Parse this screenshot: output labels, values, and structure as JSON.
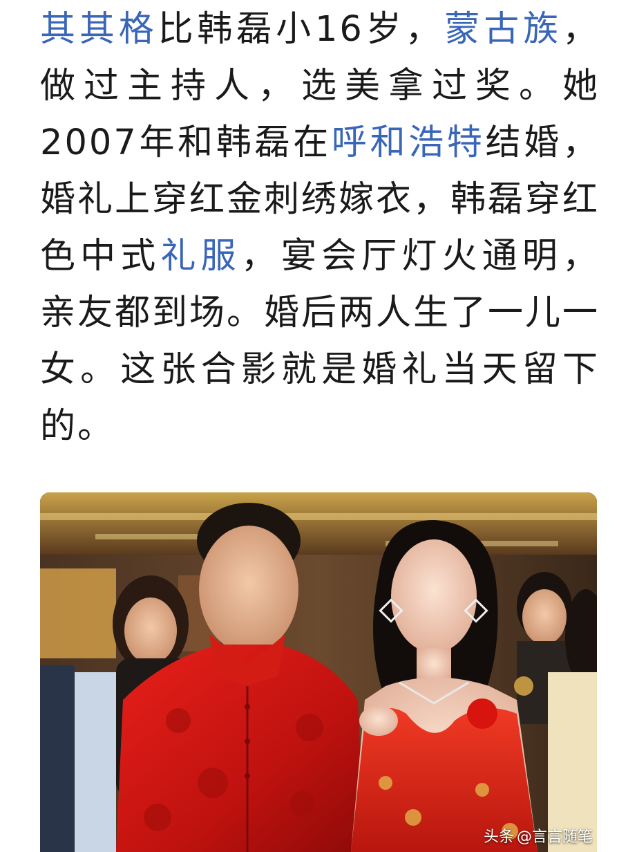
{
  "article": {
    "segments": [
      {
        "text": "其其格",
        "link": true
      },
      {
        "text": "比韩磊小16岁，",
        "link": false
      },
      {
        "text": "蒙古族",
        "link": true
      },
      {
        "text": "，做过主持人，选美拿过奖。她2007年和韩磊在",
        "link": false
      },
      {
        "text": "呼和浩特",
        "link": true
      },
      {
        "text": "结婚，婚礼上穿红金刺绣嫁衣，韩磊穿红色中式",
        "link": false
      },
      {
        "text": "礼服",
        "link": true
      },
      {
        "text": "，宴会厅灯火通明，亲友都到场。婚后两人生了一儿一女。这张合影就是婚礼当天留下的。",
        "link": false
      }
    ]
  },
  "photo": {
    "watermark_brand": "头条",
    "watermark_author": "@言言随笔"
  },
  "colors": {
    "link": "#3a66b8",
    "text": "#1a1a1a"
  }
}
